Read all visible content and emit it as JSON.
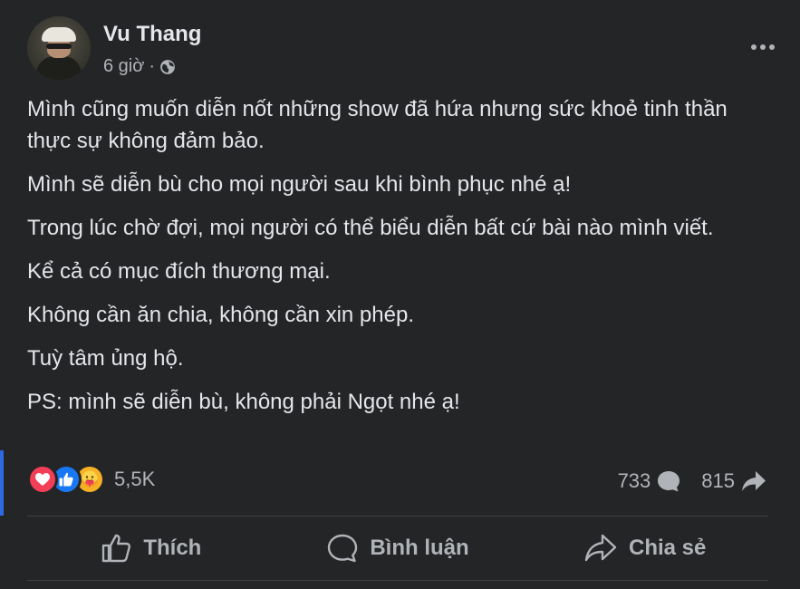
{
  "post": {
    "author": "Vu Thang",
    "time": "6 giờ",
    "separator": "·",
    "privacy_icon": "globe-icon",
    "paragraphs": [
      "Mình cũng muốn diễn nốt những show đã hứa nhưng sức khoẻ tinh thần thực sự không đảm bảo.",
      " Mình sẽ diễn bù cho mọi người sau khi bình phục nhé ạ!",
      " Trong lúc chờ đợi, mọi người có thể biểu diễn bất cứ bài nào mình viết.",
      " Kể cả có mục đích thương mại.",
      " Không cần ăn chia, không cần xin phép.",
      " Tuỳ tâm ủng hộ.",
      "PS: mình sẽ diễn bù, không phải Ngọt nhé ạ!"
    ]
  },
  "reactions": {
    "types": [
      "love-icon",
      "like-icon",
      "care-icon"
    ],
    "count": "5,5K"
  },
  "stats": {
    "comments": "733",
    "shares": "815"
  },
  "actions": {
    "like_label": "Thích",
    "comment_label": "Bình luận",
    "share_label": "Chia sẻ"
  },
  "colors": {
    "card_bg": "#242526",
    "text_primary": "#e4e6eb",
    "text_secondary": "#b0b3b8",
    "like_blue": "#1877f2",
    "love_red": "#f33e58",
    "care_yellow": "#f7b125"
  }
}
